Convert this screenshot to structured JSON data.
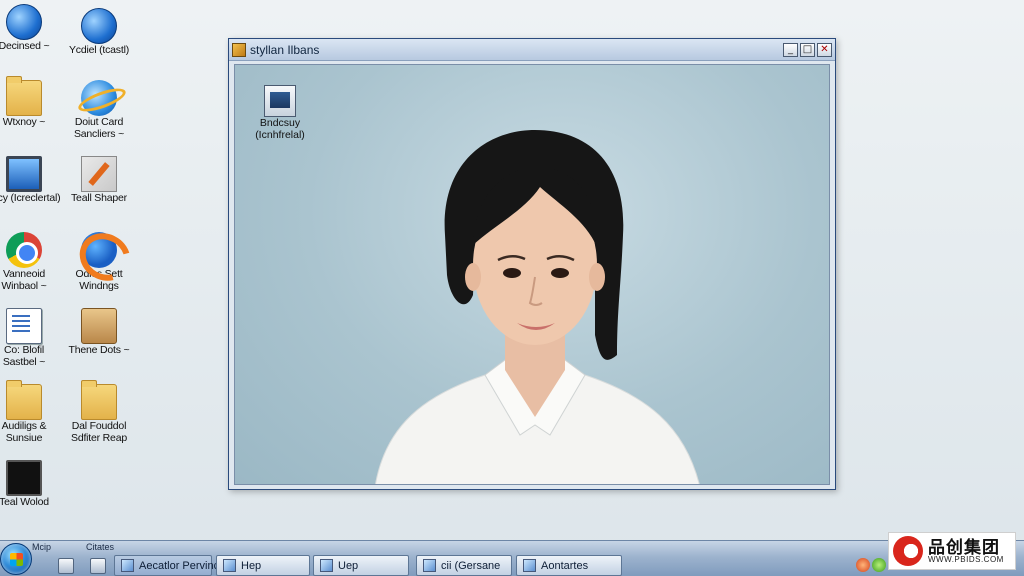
{
  "desktop": {
    "icons": [
      {
        "label": "Decinsed ~",
        "icon": "blue-swirl-folder-icon"
      },
      {
        "label": "Ycdiel (tcastl)",
        "icon": "globe-window-icon"
      },
      {
        "label": "Wtxnoy ~",
        "icon": "folder-icon"
      },
      {
        "label": "Doiut Card Sancliers ~",
        "icon": "internet-explorer-icon"
      },
      {
        "label": "Glcy (Icreclertal)",
        "icon": "monitor-icon"
      },
      {
        "label": "Teall Shaper",
        "icon": "tool-icon"
      },
      {
        "label": "Vanneoid Winbaol ~",
        "icon": "chrome-icon"
      },
      {
        "label": "Odies Sett Windngs",
        "icon": "firefox-icon"
      },
      {
        "label": "Co: Blofil Sastbel ~",
        "icon": "document-icon"
      },
      {
        "label": "Thene Dots ~",
        "icon": "briefcase-icon"
      },
      {
        "label": "Audiligs & Sunsiue",
        "icon": "folder-icon"
      },
      {
        "label": "Dal Fouddol Sdfiter Reap",
        "icon": "folder-icon"
      },
      {
        "label": "Teal Wolod",
        "icon": "terminal-icon"
      }
    ]
  },
  "window": {
    "title": "styllan Ilbans",
    "buttons": {
      "minimize": "_",
      "maximize": "□",
      "close": "✕"
    },
    "content_icon": {
      "label": "Bndcsuy (Icnhfrelal)",
      "icon": "document-window-icon"
    },
    "photo_description_icon": "portrait-photo"
  },
  "taskbar": {
    "top_labels": [
      "Mcip",
      "Citates"
    ],
    "tasks": [
      {
        "label": "Aecatlor Pervince",
        "active": true
      },
      {
        "label": "Hep",
        "active": false
      },
      {
        "label": "Uep",
        "active": false
      },
      {
        "label": "cii (Gersane",
        "active": false
      },
      {
        "label": "Aontartes",
        "active": false
      }
    ],
    "tray_clock": "~~~"
  },
  "watermark": {
    "text_cn": "品创集团",
    "text_en": "WWW.PBIDS.COM"
  },
  "colors": {
    "titlebar": "#b7c9e0",
    "taskbar": "#9db3ce",
    "window_bg": "#aac4cf",
    "watermark_red": "#d9261c"
  }
}
